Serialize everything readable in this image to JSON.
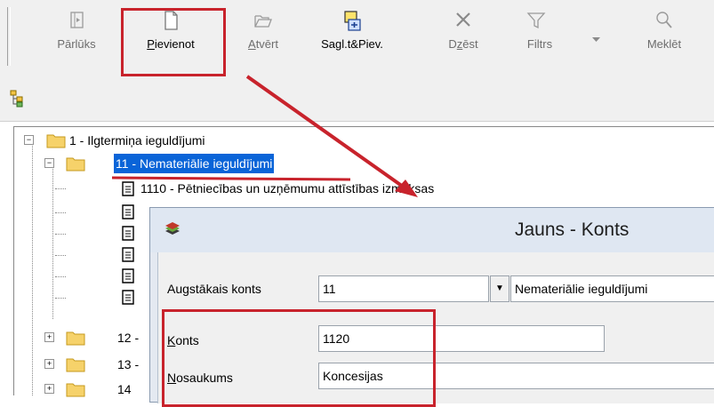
{
  "toolbar": {
    "buttons": [
      {
        "label": "Pārlūks",
        "underline": "",
        "icon": "browser-icon",
        "enabled": false
      },
      {
        "label": "Pievienot",
        "underline": "P",
        "icon": "new-document-icon",
        "enabled": true
      },
      {
        "label": "Atvērt",
        "underline": "A",
        "icon": "open-folder-icon",
        "enabled": false
      },
      {
        "label": "Sagl.t&Piev.",
        "underline": "",
        "icon": "save-add-icon",
        "enabled": true
      },
      {
        "label": "Dzēst",
        "underline": "z",
        "icon": "delete-icon",
        "enabled": false
      },
      {
        "label": "Filtrs",
        "underline": "",
        "icon": "filter-icon",
        "enabled": false
      },
      {
        "label": "Meklēt",
        "underline": "",
        "icon": "search-icon",
        "enabled": false
      }
    ]
  },
  "tree": {
    "root": {
      "label": "1 - Ilgtermiņa ieguldījumi"
    },
    "selected": {
      "label": "11 - Nemateriālie ieguldījumi"
    },
    "child": {
      "label": "1110 - Pētniecības un uzņēmumu attīstības izmaksas"
    },
    "siblings": [
      {
        "label": "12 -"
      },
      {
        "label": "13 -"
      },
      {
        "label": "14"
      }
    ]
  },
  "dialog": {
    "title": "Jauns - Konts",
    "parent_label": "Augstākais konts",
    "parent_value": "11",
    "parent_name": "Nemateriālie ieguldījumi",
    "account_label": "Konts",
    "account_value": "1120",
    "name_label": "Nosaukums",
    "name_value": "Koncesijas"
  },
  "colors": {
    "highlight": "#c8232c",
    "selection": "#0a64d8"
  }
}
